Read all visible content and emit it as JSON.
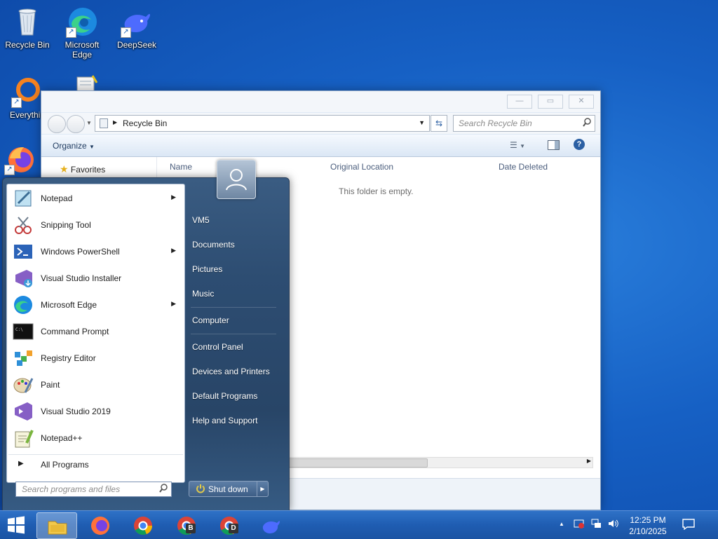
{
  "desktop": {
    "icons": [
      {
        "label": "Recycle Bin",
        "icon": "recycle-bin-icon"
      },
      {
        "label": "Microsoft Edge",
        "icon": "edge-icon"
      },
      {
        "label": "DeepSeek",
        "icon": "deepseek-icon"
      },
      {
        "label": "Everythin",
        "icon": "everything-icon"
      }
    ]
  },
  "explorer": {
    "address": "Recycle Bin",
    "search_placeholder": "Search Recycle Bin",
    "organize_label": "Organize",
    "nav_favorites": "Favorites",
    "columns": [
      "Name",
      "Original Location",
      "Date Deleted"
    ],
    "empty_message": "This folder is empty."
  },
  "start_menu": {
    "programs": [
      {
        "label": "Notepad",
        "icon": "notepad-icon",
        "submenu": true
      },
      {
        "label": "Snipping Tool",
        "icon": "snipping-tool-icon",
        "submenu": false
      },
      {
        "label": "Windows PowerShell",
        "icon": "powershell-icon",
        "submenu": true
      },
      {
        "label": "Visual Studio Installer",
        "icon": "vs-installer-icon",
        "submenu": false
      },
      {
        "label": "Microsoft Edge",
        "icon": "edge-icon",
        "submenu": true
      },
      {
        "label": "Command Prompt",
        "icon": "command-prompt-icon",
        "submenu": false
      },
      {
        "label": "Registry Editor",
        "icon": "registry-editor-icon",
        "submenu": false
      },
      {
        "label": "Paint",
        "icon": "paint-icon",
        "submenu": false
      },
      {
        "label": "Visual Studio 2019",
        "icon": "visual-studio-icon",
        "submenu": false
      },
      {
        "label": "Notepad++",
        "icon": "notepad-plus-plus-icon",
        "submenu": false
      }
    ],
    "all_programs": "All Programs",
    "search_placeholder": "Search programs and files",
    "right_links": [
      "VM5",
      "Documents",
      "Pictures",
      "Music",
      "Computer",
      "Control Panel",
      "Devices and Printers",
      "Default Programs",
      "Help and Support"
    ],
    "shutdown_label": "Shut down"
  },
  "taskbar": {
    "items": [
      "start-button",
      "file-explorer",
      "firefox",
      "chrome",
      "chrome-profile-b",
      "chrome-profile-d",
      "deepseek"
    ],
    "profile_b": "B",
    "profile_d": "D",
    "time": "12:25 PM",
    "date": "2/10/2025"
  },
  "colors": {
    "desktop": "#1660c4",
    "taskbar": "#1f5db2",
    "start_right_panel": "#2d4d72"
  }
}
